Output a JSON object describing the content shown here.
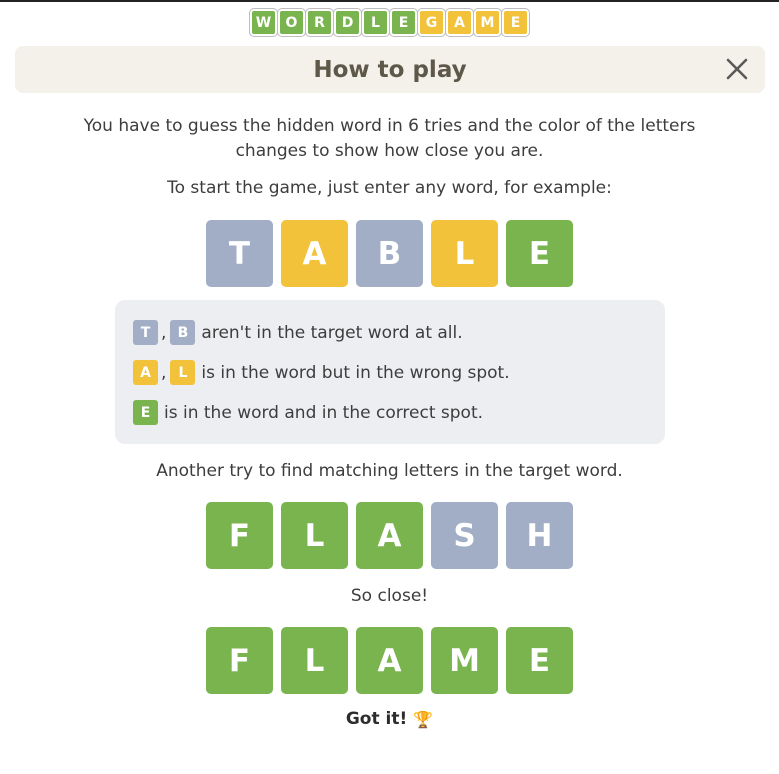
{
  "colors": {
    "green": "#79b44f",
    "yellow": "#f2c23a",
    "gray": "#a2aec5"
  },
  "logo": [
    {
      "letter": "W",
      "state": "green"
    },
    {
      "letter": "O",
      "state": "green"
    },
    {
      "letter": "R",
      "state": "green"
    },
    {
      "letter": "D",
      "state": "green"
    },
    {
      "letter": "L",
      "state": "green"
    },
    {
      "letter": "E",
      "state": "green"
    },
    {
      "letter": "G",
      "state": "yellow"
    },
    {
      "letter": "A",
      "state": "yellow"
    },
    {
      "letter": "M",
      "state": "yellow"
    },
    {
      "letter": "E",
      "state": "yellow"
    }
  ],
  "header": {
    "title": "How to play",
    "close_icon": "close-icon"
  },
  "intro": {
    "line1": "You have to guess the hidden word in 6 tries and the color of the letters",
    "line2": "changes to show how close you are.",
    "start": "To start the game, just enter any word, for example:"
  },
  "example1": [
    {
      "letter": "T",
      "state": "gray"
    },
    {
      "letter": "A",
      "state": "yellow"
    },
    {
      "letter": "B",
      "state": "gray"
    },
    {
      "letter": "L",
      "state": "yellow"
    },
    {
      "letter": "E",
      "state": "green"
    }
  ],
  "legend": {
    "gray_letters": [
      "T",
      "B"
    ],
    "gray_text": "aren't in the target word at all.",
    "yellow_letters": [
      "A",
      "L"
    ],
    "yellow_text": "is in the word but in the wrong spot.",
    "green_letters": [
      "E"
    ],
    "green_text": "is in the word and in the correct spot.",
    "separator": ","
  },
  "another_try": "Another try to find matching letters in the target word.",
  "example2": [
    {
      "letter": "F",
      "state": "green"
    },
    {
      "letter": "L",
      "state": "green"
    },
    {
      "letter": "A",
      "state": "green"
    },
    {
      "letter": "S",
      "state": "gray"
    },
    {
      "letter": "H",
      "state": "gray"
    }
  ],
  "so_close": "So close!",
  "example3": [
    {
      "letter": "F",
      "state": "green"
    },
    {
      "letter": "L",
      "state": "green"
    },
    {
      "letter": "A",
      "state": "green"
    },
    {
      "letter": "M",
      "state": "green"
    },
    {
      "letter": "E",
      "state": "green"
    }
  ],
  "got_it": {
    "label": "Got it!",
    "icon": "trophy-icon",
    "glyph": "🏆"
  }
}
